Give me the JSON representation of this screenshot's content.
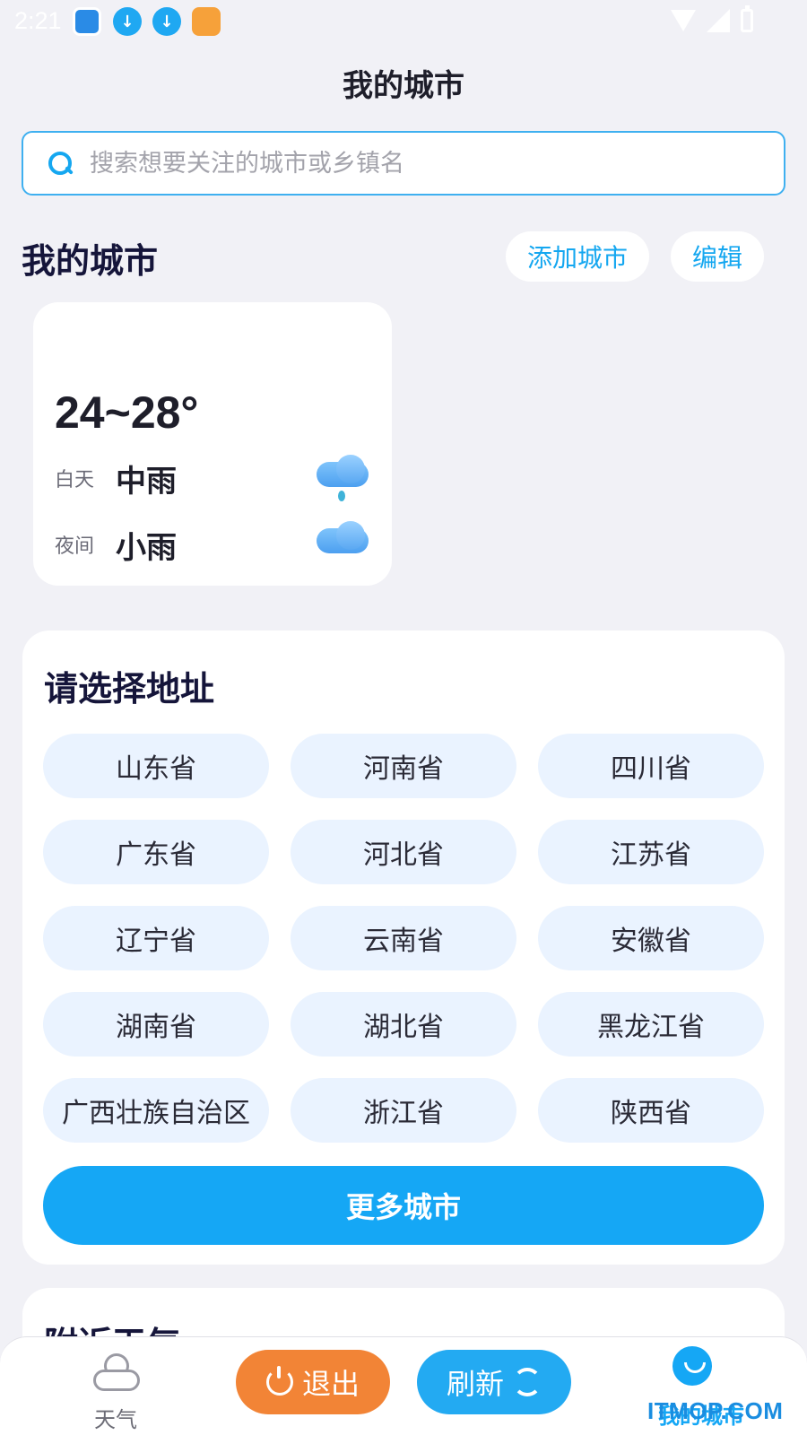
{
  "status_bar": {
    "time": "2:21",
    "icons": [
      "weather-app-icon",
      "download-icon",
      "download-icon",
      "game-app-icon",
      "wifi-icon",
      "signal-icon",
      "battery-icon"
    ]
  },
  "header": {
    "title": "我的城市"
  },
  "search": {
    "placeholder": "搜索想要关注的城市或乡镇名"
  },
  "my_cities": {
    "title": "我的城市",
    "add_label": "添加城市",
    "edit_label": "编辑",
    "cards": [
      {
        "temp_range": "24~28°",
        "day_label": "白天",
        "day_condition": "中雨",
        "night_label": "夜间",
        "night_condition": "小雨"
      }
    ]
  },
  "address": {
    "title": "请选择地址",
    "provinces": [
      "山东省",
      "河南省",
      "四川省",
      "广东省",
      "河北省",
      "江苏省",
      "辽宁省",
      "云南省",
      "安徽省",
      "湖南省",
      "湖北省",
      "黑龙江省",
      "广西壮族自治区",
      "浙江省",
      "陕西省"
    ],
    "more_label": "更多城市"
  },
  "nearby": {
    "title": "附近天气"
  },
  "bottom_nav": {
    "weather_label": "天气",
    "exit_label": "退出",
    "refresh_label": "刷新",
    "my_city_label": "我的城市"
  },
  "watermark": "ITMOP.COM",
  "colors": {
    "accent": "#15a7f5",
    "exit": "#f28436",
    "chip_bg": "#eaf3ff",
    "page_bg": "#f1f1f6"
  }
}
